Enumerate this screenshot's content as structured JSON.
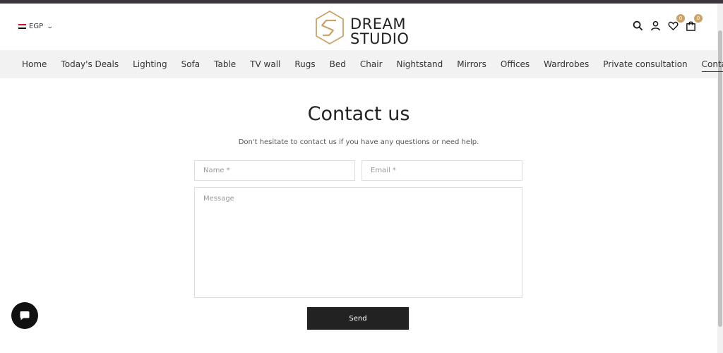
{
  "header": {
    "currency": {
      "code": "EGP",
      "flag_colors": [
        "#ce1126",
        "#ffffff",
        "#000000"
      ]
    },
    "logo": {
      "line1": "DREAM",
      "line2": "STUDIO",
      "accent_color": "#c9a36a"
    },
    "icons": {
      "search": "search-icon",
      "account": "user-icon",
      "wishlist": {
        "icon": "heart-icon",
        "count": "0"
      },
      "cart": {
        "icon": "bag-icon",
        "count": "0"
      }
    }
  },
  "nav": {
    "items": [
      "Home",
      "Today's Deals",
      "Lighting",
      "Sofa",
      "Table",
      "TV wall",
      "Rugs",
      "Bed",
      "Chair",
      "Nightstand",
      "Mirrors",
      "Offices",
      "Wardrobes",
      "Private consultation",
      "Contact us"
    ],
    "active": "Contact us"
  },
  "page": {
    "title": "Contact us",
    "subtitle": "Don't hesitate to contact us if you have any questions or need help."
  },
  "form": {
    "name_placeholder": "Name *",
    "email_placeholder": "Email *",
    "message_placeholder": "Message",
    "send_label": "Send"
  },
  "chat": {
    "icon": "chat-bubble-icon"
  }
}
